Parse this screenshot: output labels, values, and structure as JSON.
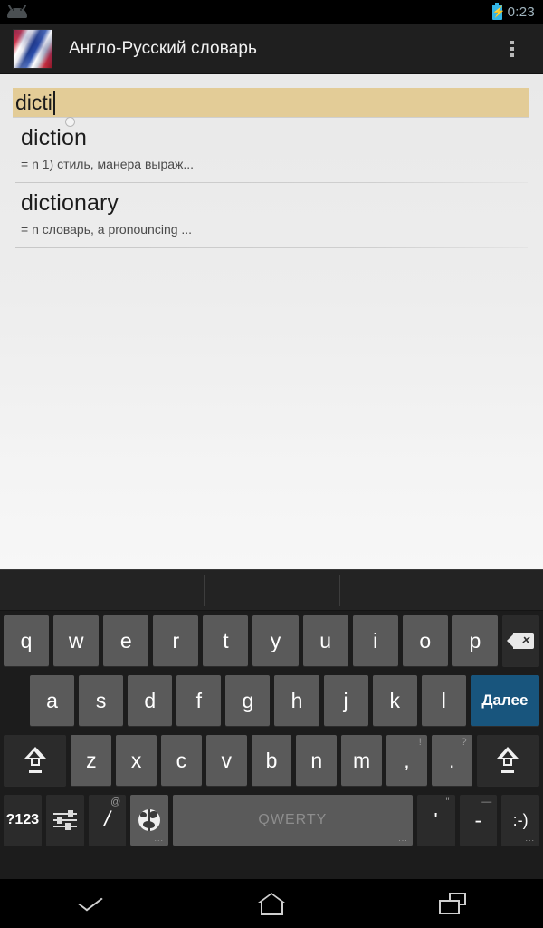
{
  "status_bar": {
    "notification_icon": "android-head-icon",
    "battery_icon": "battery-charging-icon",
    "clock": "0:23",
    "battery_color": "#33b5e5",
    "clock_color": "#9fb3bd"
  },
  "action_bar": {
    "app_icon": "uk-russia-flags-icon",
    "title": "Англо-Русский словарь",
    "overflow_icon": "overflow-menu-icon",
    "background": "#1f1f1f"
  },
  "search": {
    "value": "dicti",
    "placeholder": "",
    "highlight_color": "#e3cc97",
    "handle_icon": "text-selection-handle-icon"
  },
  "results": [
    {
      "title": "diction",
      "definition": "= n  1) стиль, манера выраж..."
    },
    {
      "title": "dictionary",
      "definition": "= n словарь, a pronouncing ..."
    }
  ],
  "keyboard": {
    "suggestion_strip": {
      "suggestions": []
    },
    "row1": [
      {
        "label": "q",
        "name": "key-q"
      },
      {
        "label": "w",
        "name": "key-w"
      },
      {
        "label": "e",
        "name": "key-e"
      },
      {
        "label": "r",
        "name": "key-r"
      },
      {
        "label": "t",
        "name": "key-t"
      },
      {
        "label": "y",
        "name": "key-y"
      },
      {
        "label": "u",
        "name": "key-u"
      },
      {
        "label": "i",
        "name": "key-i"
      },
      {
        "label": "o",
        "name": "key-o"
      },
      {
        "label": "p",
        "name": "key-p"
      }
    ],
    "backspace": {
      "icon": "backspace-icon"
    },
    "row2": [
      {
        "label": "a",
        "name": "key-a"
      },
      {
        "label": "s",
        "name": "key-s"
      },
      {
        "label": "d",
        "name": "key-d"
      },
      {
        "label": "f",
        "name": "key-f"
      },
      {
        "label": "g",
        "name": "key-g"
      },
      {
        "label": "h",
        "name": "key-h"
      },
      {
        "label": "j",
        "name": "key-j"
      },
      {
        "label": "k",
        "name": "key-k"
      },
      {
        "label": "l",
        "name": "key-l"
      }
    ],
    "enter": {
      "label": "Далее",
      "color": "#18557d"
    },
    "row3": [
      {
        "label": "z",
        "name": "key-z",
        "sup": ""
      },
      {
        "label": "x",
        "name": "key-x",
        "sup": ""
      },
      {
        "label": "c",
        "name": "key-c",
        "sup": ""
      },
      {
        "label": "v",
        "name": "key-v",
        "sup": ""
      },
      {
        "label": "b",
        "name": "key-b",
        "sup": ""
      },
      {
        "label": "n",
        "name": "key-n",
        "sup": ""
      },
      {
        "label": "m",
        "name": "key-m",
        "sup": ""
      },
      {
        "label": ",",
        "name": "key-comma",
        "sup": "!"
      },
      {
        "label": ".",
        "name": "key-period",
        "sup": "?"
      }
    ],
    "shift_left": {
      "icon": "shift-icon"
    },
    "shift_right": {
      "icon": "shift-icon"
    },
    "row4": {
      "symbols": {
        "label": "?123",
        "name": "key-symbols"
      },
      "settings": {
        "icon": "sliders-settings-icon"
      },
      "slash": {
        "label": "/",
        "sup": "@",
        "name": "key-slash"
      },
      "language": {
        "icon": "globe-language-icon",
        "dots": "..."
      },
      "space": {
        "label": "QWERTY",
        "dots": "..."
      },
      "apostrophe": {
        "label": "'",
        "sup": "\"",
        "name": "key-apostrophe"
      },
      "hyphen": {
        "label": "-",
        "sup": "—",
        "name": "key-hyphen"
      },
      "emoji": {
        "label": ":-)",
        "dots": "...",
        "name": "key-emoji"
      }
    },
    "key_color": "#5a5a5a",
    "dark_key_color": "#2b2b2b",
    "background": "#1c1c1c"
  },
  "nav_bar": {
    "back_icon": "chevron-down-hide-keyboard-icon",
    "home_icon": "home-icon",
    "recents_icon": "recent-apps-icon"
  }
}
